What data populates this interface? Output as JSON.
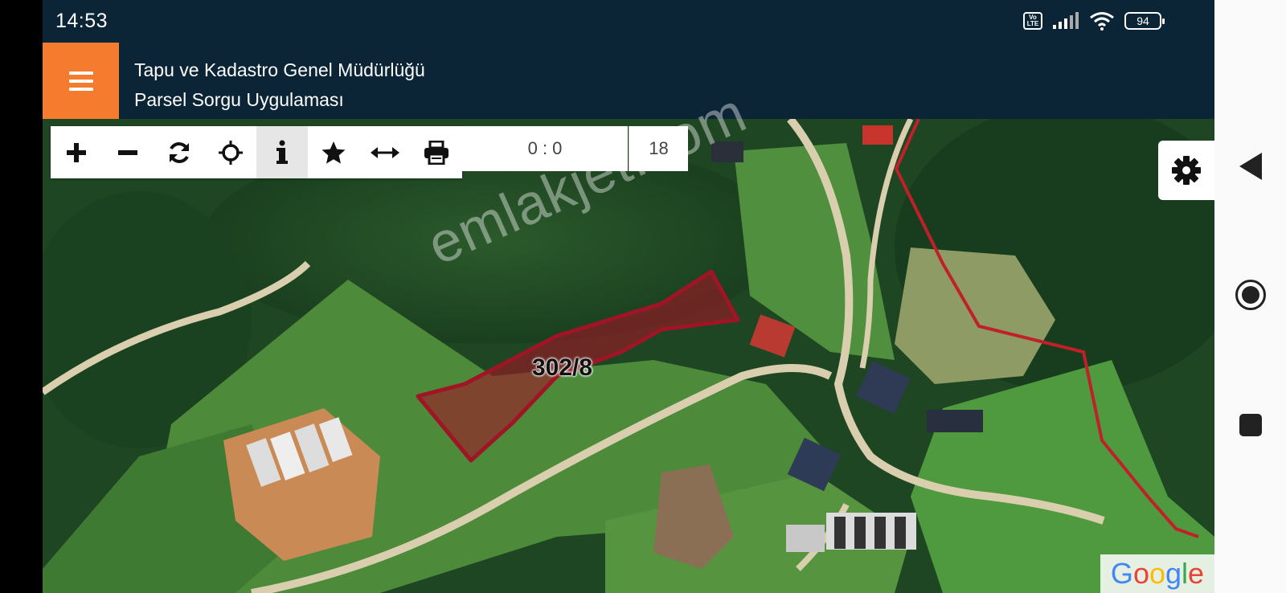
{
  "status_bar": {
    "time": "14:53",
    "network_badge": "Vo LTE",
    "battery": "94",
    "icons": [
      "volte-icon",
      "signal-icon",
      "wifi-icon",
      "battery-icon"
    ]
  },
  "header": {
    "title_line1": "Tapu ve Kadastro Genel Müdürlüğü",
    "title_line2": "Parsel Sorgu Uygulaması",
    "menu_icon": "hamburger-menu-icon",
    "accent_color": "#f57b2e",
    "bar_color": "#0b2436"
  },
  "toolbar": {
    "tools": [
      {
        "icon": "zoom-in-icon",
        "active": false
      },
      {
        "icon": "zoom-out-icon",
        "active": false
      },
      {
        "icon": "refresh-icon",
        "active": false
      },
      {
        "icon": "locate-icon",
        "active": false
      },
      {
        "icon": "info-icon",
        "active": true
      },
      {
        "icon": "star-icon",
        "active": false
      },
      {
        "icon": "measure-icon",
        "active": false
      },
      {
        "icon": "print-icon",
        "active": false
      }
    ],
    "coordinates": "0 : 0",
    "zoom_level": "18"
  },
  "map": {
    "parcel_label": "302/8",
    "watermark": "emlakjet.com",
    "attribution": {
      "G": "G",
      "o1": "o",
      "o2": "o",
      "g": "g",
      "l": "l",
      "e": "e"
    },
    "parcel_border_color": "#a01525",
    "boundary_color": "#c0202a"
  },
  "settings": {
    "icon": "gear-icon"
  },
  "system_nav": {
    "icons": [
      "back-icon",
      "home-icon",
      "recents-icon"
    ]
  }
}
